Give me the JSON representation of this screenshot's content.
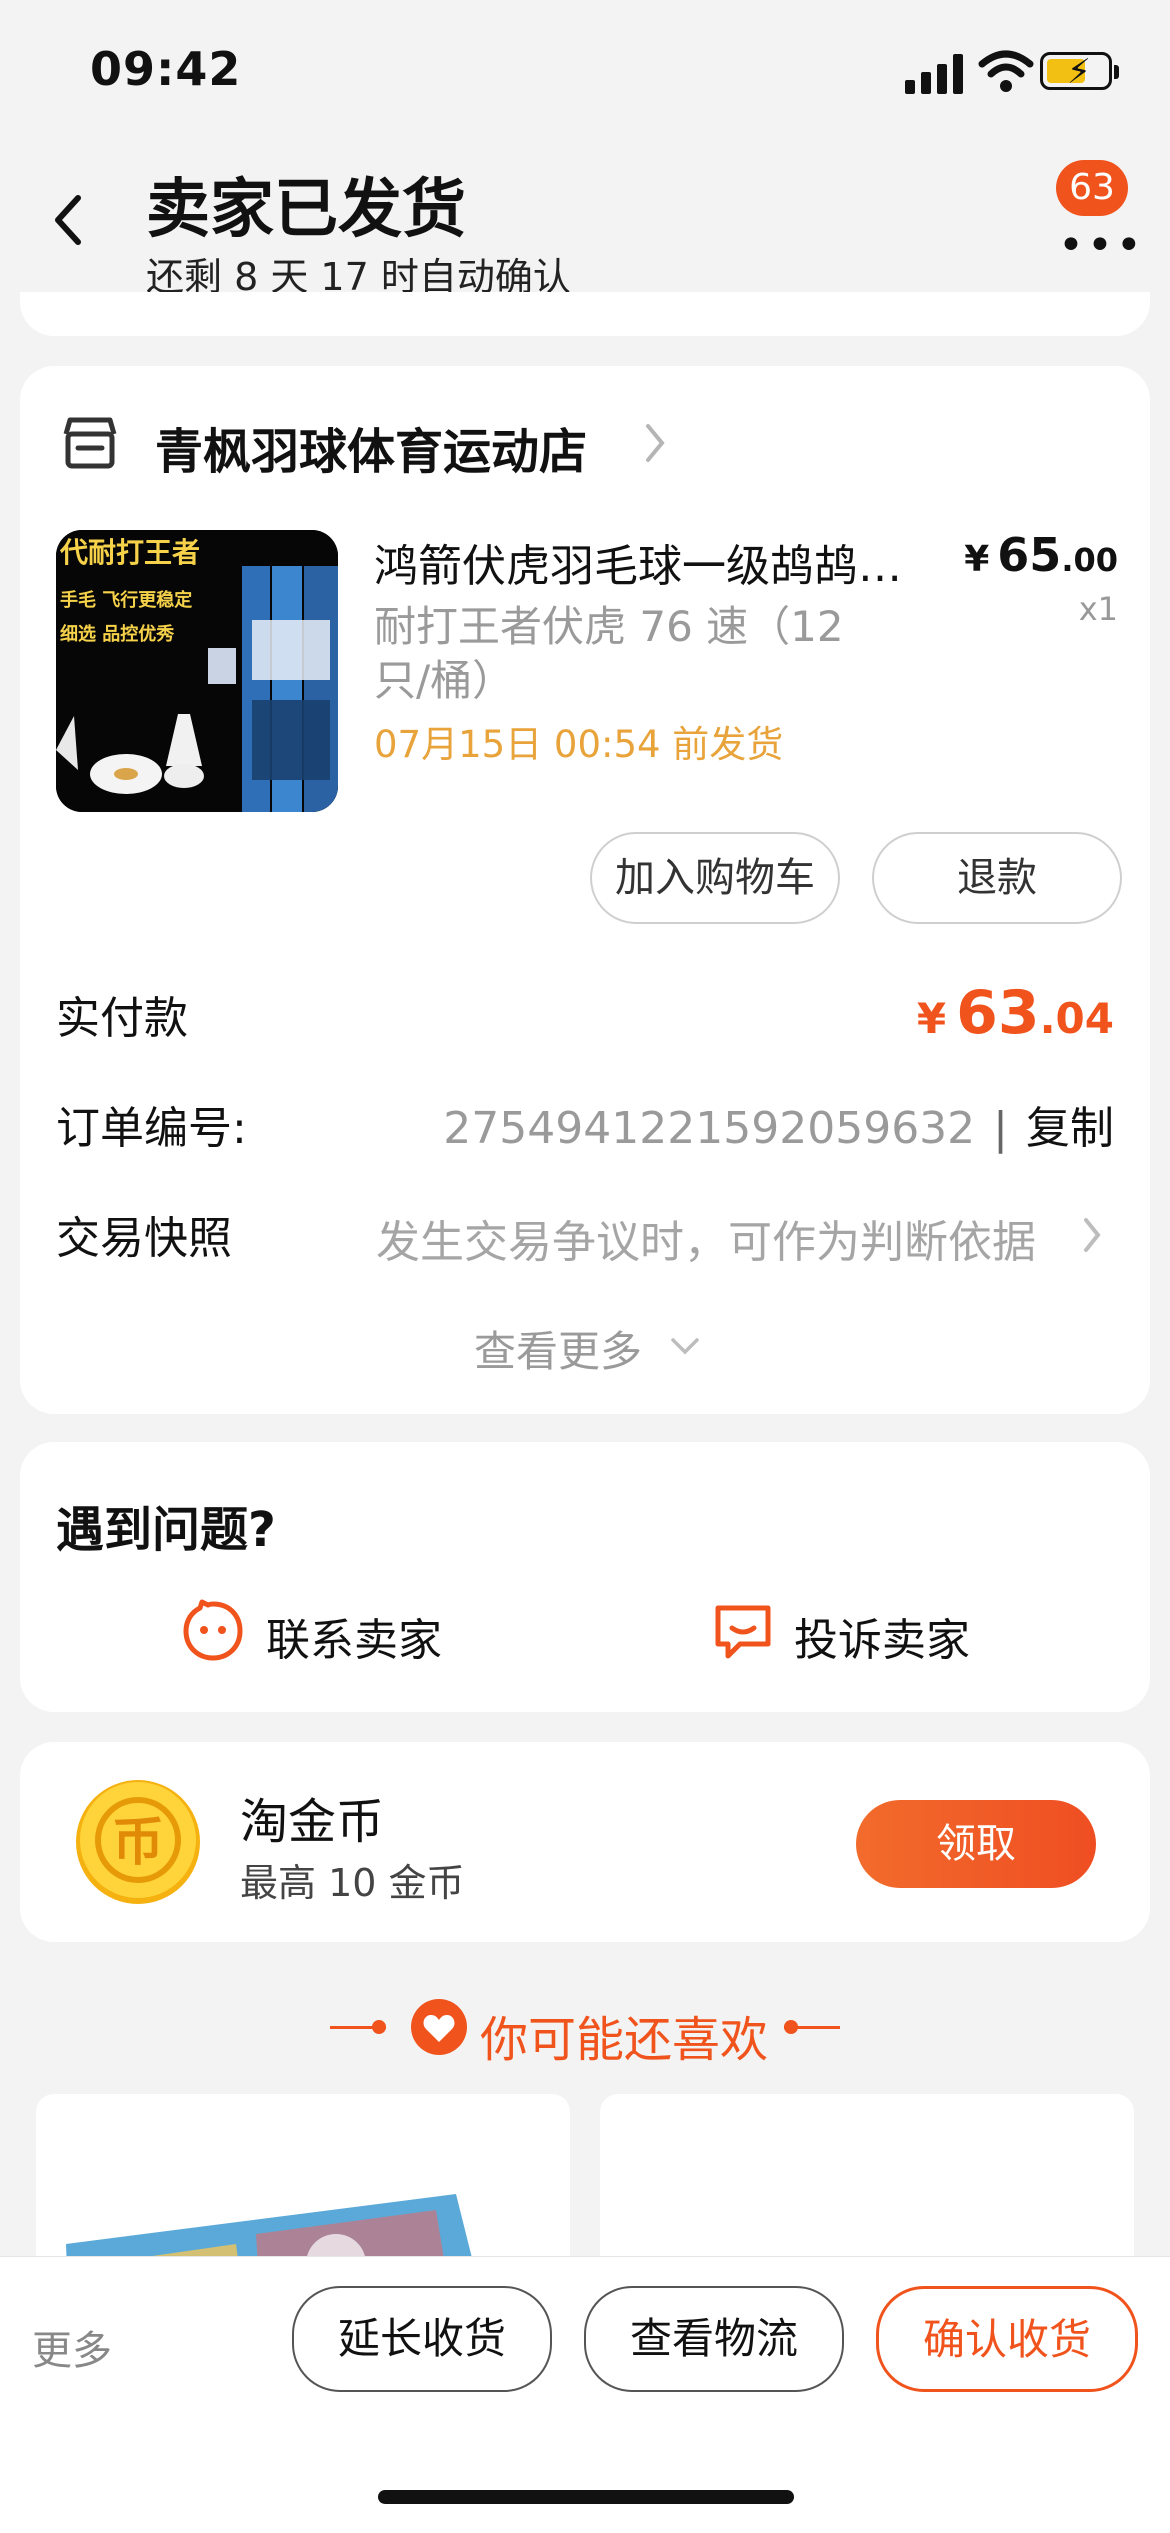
{
  "status_bar": {
    "time": "09:42"
  },
  "header": {
    "title": "卖家已发货",
    "subtitle": "还剩 8 天 17 时自动确认",
    "more_badge": "63"
  },
  "shop": {
    "name": "青枫羽球体育运动店"
  },
  "product": {
    "title": "鸿箭伏虎羽毛球一级鸪鸪…",
    "sku": "耐打王者伏虎 76 速（12只/桶）",
    "ship_time": "07月15日 00:54 前发货",
    "price_currency": "¥",
    "price_int": "65",
    "price_dec": ".00",
    "quantity": "x1",
    "image_lines": [
      "代耐打王者",
      "手毛  飞行更稳定",
      "细选  品控优秀"
    ]
  },
  "product_actions": {
    "add_cart": "加入购物车",
    "refund": "退款"
  },
  "summary": {
    "paid_label": "实付款",
    "paid_currency": "¥",
    "paid_int": "63",
    "paid_dec": ".04",
    "order_no_label": "订单编号:",
    "order_no": "2754941221592059632",
    "separator": "|",
    "copy_label": "复制",
    "snapshot_label": "交易快照",
    "snapshot_hint": "发生交易争议时，可作为判断依据",
    "see_more": "查看更多"
  },
  "problem": {
    "title": "遇到问题?",
    "contact_seller": "联系卖家",
    "complain_seller": "投诉卖家"
  },
  "coins": {
    "title": "淘金币",
    "subtitle": "最高 10 金币",
    "claim": "领取",
    "coin_glyph": "币"
  },
  "recommend": {
    "title": "你可能还喜欢"
  },
  "bottom_bar": {
    "more": "更多",
    "extend": "延长收货",
    "logistics": "查看物流",
    "confirm": "确认收货"
  },
  "colors": {
    "accent": "#f0531c",
    "ship_time": "#e8a33a",
    "background": "#f3f3f3"
  }
}
